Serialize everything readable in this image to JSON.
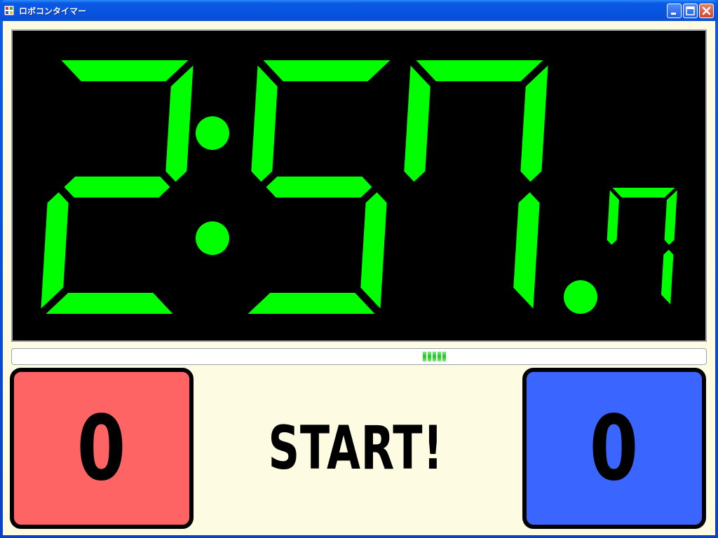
{
  "window": {
    "title": "ロボコンタイマー"
  },
  "timer": {
    "minutes": "2",
    "seconds": "57",
    "tenths": "7",
    "color": "#00ff00"
  },
  "progress": {
    "chunks": 5
  },
  "scores": {
    "red": "0",
    "blue": "0",
    "red_color": "#ff6464",
    "blue_color": "#3b65ff"
  },
  "start_label": "START!",
  "icons": [
    "app-icon",
    "minimize-icon",
    "maximize-icon",
    "close-icon"
  ]
}
